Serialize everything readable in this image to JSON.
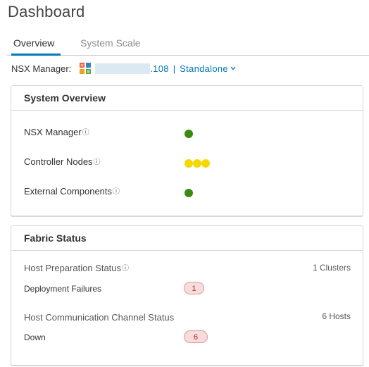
{
  "page": {
    "title": "Dashboard"
  },
  "tabs": [
    {
      "label": "Overview",
      "active": true
    },
    {
      "label": "System Scale",
      "active": false
    }
  ],
  "manager": {
    "label": "NSX Manager:",
    "ip_suffix": ".108",
    "separator": "|",
    "mode": "Standalone"
  },
  "system_overview": {
    "title": "System Overview",
    "items": [
      {
        "label": "NSX Manager",
        "status_color": "#3b8b12",
        "dots": 1
      },
      {
        "label": "Controller Nodes",
        "status_color": "#f5d800",
        "dots": 3
      },
      {
        "label": "External Components",
        "status_color": "#3b8b12",
        "dots": 1
      }
    ]
  },
  "fabric_status": {
    "title": "Fabric Status",
    "host_prep": {
      "label": "Host Preparation Status",
      "count_text": "1 Clusters",
      "sub_label": "Deployment Failures",
      "badge": "1"
    },
    "host_comm": {
      "label": "Host Communication Channel Status",
      "count_text": "6 Hosts",
      "sub_label": "Down",
      "badge": "6"
    }
  },
  "colors": {
    "accent": "#0079b8",
    "ok": "#3b8b12",
    "warning": "#f5d800",
    "error_bg": "#f7dcdc",
    "error_text": "#b22a2a"
  }
}
